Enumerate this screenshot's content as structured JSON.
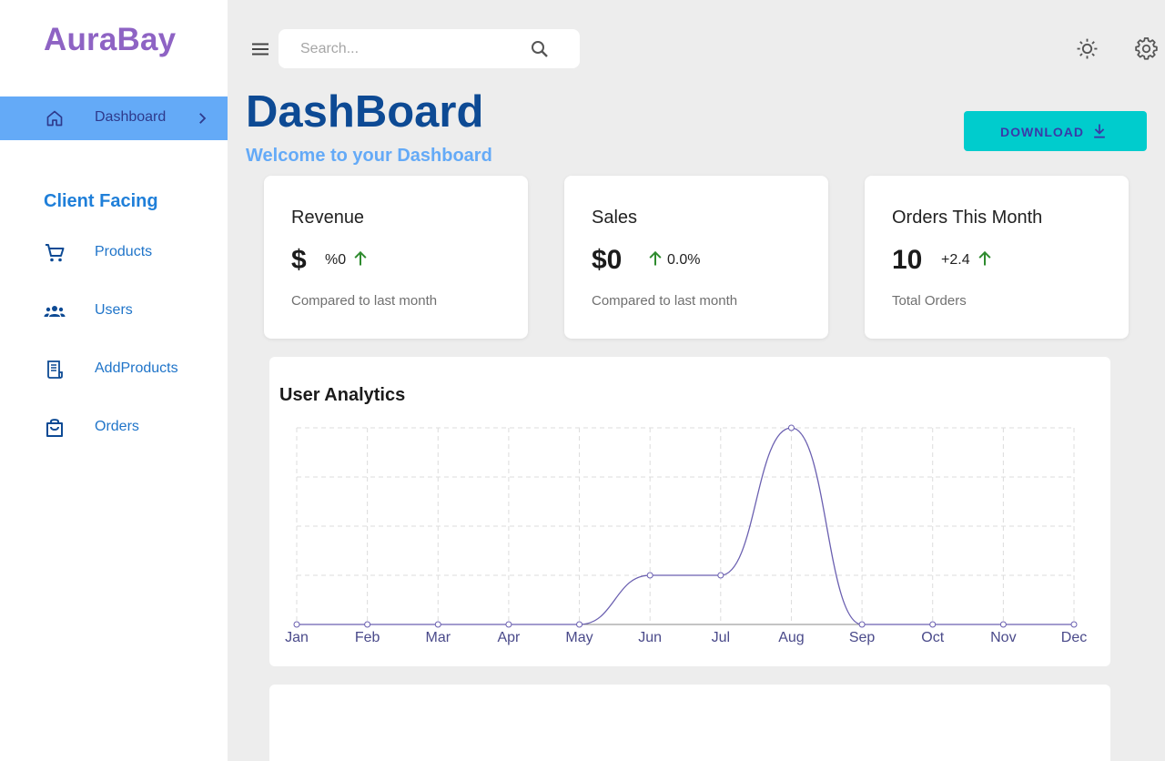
{
  "sidebar": {
    "brand": "AuraBay",
    "active_item": {
      "label": "Dashboard",
      "icon": "home-icon"
    },
    "section_title": "Client Facing",
    "items": [
      {
        "label": "Products",
        "icon": "cart-icon"
      },
      {
        "label": "Users",
        "icon": "users-icon"
      },
      {
        "label": "AddProducts",
        "icon": "receipt-icon"
      },
      {
        "label": "Orders",
        "icon": "shopping-bag-icon"
      }
    ]
  },
  "topbar": {
    "search_placeholder": "Search...",
    "icons": [
      "menu-icon",
      "search-icon",
      "sun-icon",
      "gear-icon"
    ]
  },
  "header": {
    "title": "DashBoard",
    "subtitle": "Welcome to your Dashboard",
    "download_label": "DOWNLOAD"
  },
  "cards": [
    {
      "title": "Revenue",
      "value": "$",
      "change": "%0",
      "footer": "Compared to last month"
    },
    {
      "title": "Sales",
      "value": "$0",
      "change": "0.0%",
      "footer": "Compared to last month"
    },
    {
      "title": "Orders This Month",
      "value": "10",
      "change": "+2.4",
      "footer": "Total Orders"
    }
  ],
  "analytics": {
    "title": "User Analytics"
  },
  "colors": {
    "brand": "#8e63c4",
    "active_nav": "#64aaf7",
    "title": "#0d4a94",
    "accent": "#00cccd",
    "trend_up": "#2e8b2e",
    "line": "#6a5fb0"
  },
  "chart_data": {
    "type": "line",
    "title": "User Analytics",
    "categories": [
      "Jan",
      "Feb",
      "Mar",
      "Apr",
      "May",
      "Jun",
      "Jul",
      "Aug",
      "Sep",
      "Oct",
      "Nov",
      "Dec"
    ],
    "series": [
      {
        "values": [
          0,
          0,
          0,
          0,
          0,
          1,
          1,
          4,
          0,
          0,
          0,
          0
        ]
      }
    ],
    "ylim": [
      0,
      4
    ],
    "grid": true,
    "curve": "smooth"
  }
}
